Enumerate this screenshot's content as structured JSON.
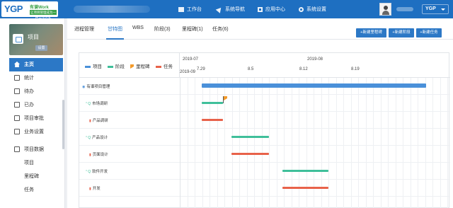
{
  "app": {
    "logo_text": "YGP",
    "logo_sub": "有谱Work",
    "logo_tag": "让项目管理成为一种工作方式",
    "user_menu": "YGP"
  },
  "topnav": [
    {
      "label": "工作台",
      "icon": "monitor-icon"
    },
    {
      "label": "系统导航",
      "icon": "navigation-arrow-icon"
    },
    {
      "label": "应用中心",
      "icon": "apps-grid-icon"
    },
    {
      "label": "系统设置",
      "icon": "gear-icon"
    }
  ],
  "sidebar": {
    "project_title": "项目",
    "project_tag": "设置",
    "items": [
      {
        "label": "主页",
        "icon": "home-icon",
        "active": true
      },
      {
        "label": "统计",
        "icon": "chart-icon"
      },
      {
        "label": "待办",
        "icon": "todo-icon"
      },
      {
        "label": "已办",
        "icon": "done-icon"
      },
      {
        "label": "项目审批",
        "icon": "approval-icon"
      },
      {
        "label": "业务设置",
        "icon": "business-settings-icon"
      },
      {
        "label": "项目数据",
        "icon": "data-icon"
      },
      {
        "label": "项目"
      },
      {
        "label": "里程碑"
      },
      {
        "label": "任务"
      }
    ]
  },
  "tabs": [
    {
      "label": "进程管理"
    },
    {
      "label": "甘特图",
      "selected": true
    },
    {
      "label": "WBS"
    },
    {
      "label": "阶段(3)"
    },
    {
      "label": "里程碑(1)"
    },
    {
      "label": "任务(6)"
    }
  ],
  "actions": {
    "new_milestone": "+新建里程碑",
    "new_phase": "+新建阶段",
    "new_task": "+新建任务"
  },
  "gantt": {
    "legend": [
      {
        "label": "项目",
        "color": "#4a90d9"
      },
      {
        "label": "阶段",
        "color": "#3fbf9a"
      },
      {
        "label": "里程碑",
        "color": "#f39a2a"
      },
      {
        "label": "任务",
        "color": "#e8624a"
      }
    ],
    "months": [
      "2019-07",
      "2019-08",
      "2019-09"
    ],
    "weeks": [
      "7.29",
      "8.5",
      "8.12",
      "8.19"
    ],
    "rows": [
      {
        "name": "有谱项目管理",
        "type": "project",
        "start": 0.08,
        "end": 0.91
      },
      {
        "name": "市场调研",
        "type": "phase",
        "start": 0.08,
        "end": 0.16,
        "milestone": 0.16
      },
      {
        "name": "产品调研",
        "type": "task",
        "start": 0.08,
        "end": 0.16
      },
      {
        "name": "产品设计",
        "type": "phase",
        "start": 0.19,
        "end": 0.33
      },
      {
        "name": "页面设计",
        "type": "task",
        "start": 0.19,
        "end": 0.33
      },
      {
        "name": "软件开发",
        "type": "phase",
        "start": 0.38,
        "end": 0.55
      },
      {
        "name": "开发",
        "type": "task",
        "start": 0.38,
        "end": 0.55
      }
    ]
  }
}
